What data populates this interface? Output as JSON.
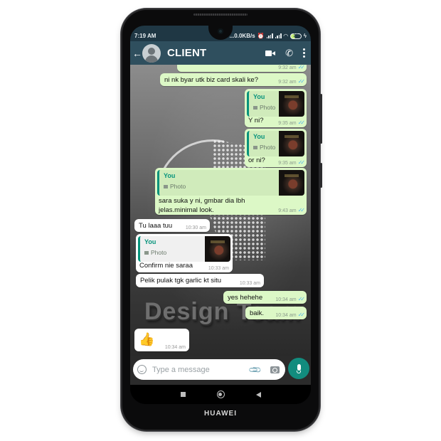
{
  "device": {
    "brand": "HUAWEI"
  },
  "status_bar": {
    "time": "7:19 AM",
    "network_speed": "...0.0KB/s",
    "icons": [
      "alarm-icon",
      "signal-icon",
      "signal-icon",
      "wifi-icon",
      "battery-icon",
      "charging-icon"
    ],
    "battery_level": "39"
  },
  "header": {
    "back_icon": "arrow-left",
    "contact_name": "CLIENT",
    "actions": [
      "video-call-icon",
      "phone-call-icon",
      "more-options-icon"
    ]
  },
  "messages": [
    {
      "direction": "out",
      "text": "",
      "time": "9:32 am",
      "read": true
    },
    {
      "direction": "out",
      "text": "ni nk byar utk biz card skali ke?",
      "time": "9:32 am",
      "read": true
    },
    {
      "direction": "out",
      "reply_to": {
        "author": "You",
        "type": "Photo"
      },
      "text": "Y ni?",
      "time": "9:35 am",
      "read": true
    },
    {
      "direction": "out",
      "reply_to": {
        "author": "You",
        "type": "Photo"
      },
      "text": "or ni?",
      "time": "9:35 am",
      "read": true
    },
    {
      "direction": "out",
      "reply_to": {
        "author": "You",
        "type": "Photo"
      },
      "text": "sara suka y ni, gmbar dia lbh jelas.minimal look.",
      "time": "9:43 am",
      "read": true
    },
    {
      "direction": "in",
      "text": "Tu laaa tuu",
      "time": "10:30 am"
    },
    {
      "direction": "in",
      "reply_to": {
        "author": "You",
        "type": "Photo"
      },
      "text": "Confirm nie saraa",
      "time": "10:33 am"
    },
    {
      "direction": "in",
      "text": "Pelik pulak tgk garlic kt situ",
      "time": "10:33 am"
    },
    {
      "direction": "out",
      "text": "yes hehehe",
      "time": "10:34 am",
      "read": true
    },
    {
      "direction": "out",
      "text": "baik.",
      "time": "10:34 am",
      "read": true
    },
    {
      "direction": "in",
      "text": "👍",
      "time": "10:34 am"
    }
  ],
  "wallpaper_text": "Design Team",
  "scroll_down_icon": "double-chevron-down",
  "composer": {
    "placeholder": "Type a message",
    "icons": [
      "emoji-icon",
      "attach-icon",
      "camera-icon",
      "mic-icon"
    ]
  },
  "nav_bar": [
    "recents-button",
    "home-button",
    "back-button"
  ],
  "colors": {
    "header": "#2f4f5e",
    "status_bar": "#1f3744",
    "outgoing_bubble": "#dcf8c6",
    "incoming_bubble": "#ffffff",
    "accent": "#07947c",
    "mic_button": "#128c7e",
    "read_ticks": "#4fb6ec"
  }
}
